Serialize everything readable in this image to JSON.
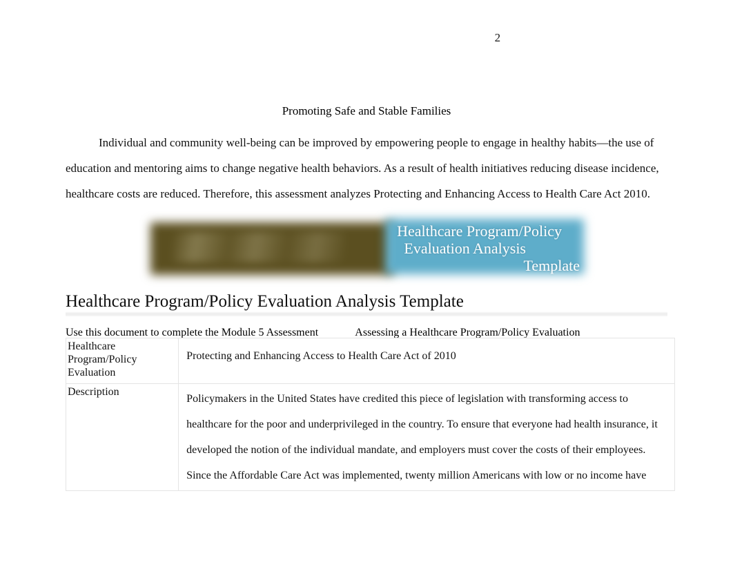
{
  "document": {
    "page_number": "2",
    "section_title": "Promoting Safe and Stable Families",
    "intro_paragraph": "Individual and community well-being can be improved by empowering people to engage in healthy habits—the use of education and mentoring aims to change negative health behaviors. As a result of health initiatives reducing disease incidence, healthcare costs are reduced. Therefore, this assessment analyzes Protecting and Enhancing Access to Health Care Act 2010."
  },
  "banner": {
    "title_line_1": "Healthcare Program/Policy",
    "title_line_2": "Evaluation Analysis",
    "title_line_3": "Template",
    "olive_color": "#5b4f20",
    "blue_color": "#5eadca",
    "text_color": "#ffffff"
  },
  "template": {
    "heading": "Healthcare Program/Policy Evaluation Analysis Template",
    "instruction_left": "Use this document to complete the Module 5 Assessment",
    "instruction_right": "Assessing a Healthcare Program/Policy Evaluation",
    "rows": [
      {
        "label": "Healthcare Program/Policy Evaluation",
        "value": "Protecting and Enhancing Access to Health Care Act of 2010"
      },
      {
        "label": "Description",
        "value": "Policymakers in the United States have credited this piece of legislation with transforming access to healthcare for the poor and underprivileged in the country. To ensure that everyone had health insurance, it developed the notion of the individual mandate, and employers must cover the costs of their employees. Since the Affordable Care Act was implemented, twenty million Americans with low or no income have"
      }
    ]
  }
}
